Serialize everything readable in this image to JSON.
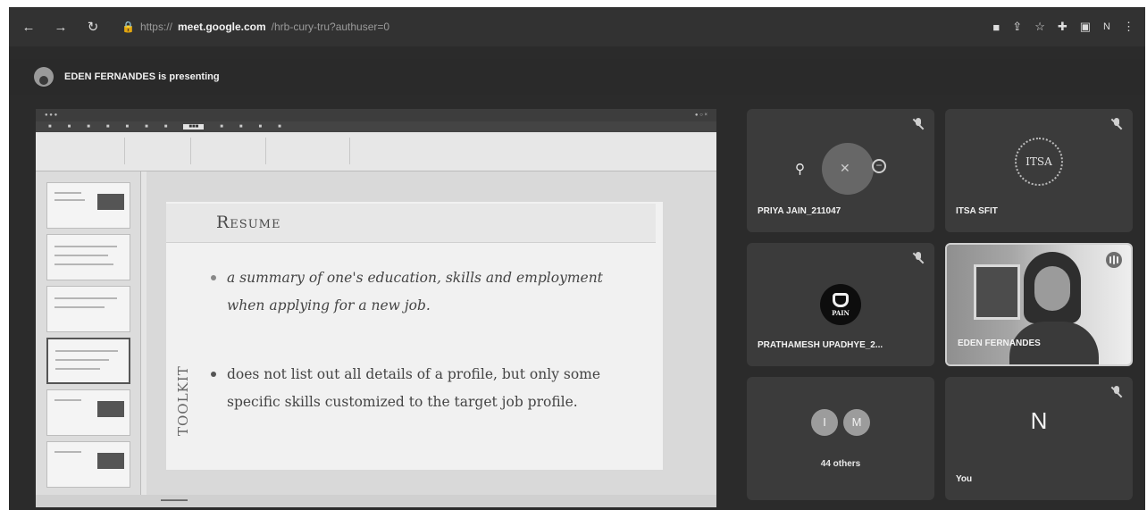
{
  "browser": {
    "url_prefix": "https://",
    "url_domain": "meet.google.com",
    "url_path": "/hrb-cury-tru?authuser=0",
    "profile_initial": "N"
  },
  "meeting": {
    "presenting_text": "EDEN FERNANDES is presenting"
  },
  "presentation": {
    "slide_title": "Resume",
    "vertical_label": "TOOLKIT",
    "bullets": [
      "a summary of one's education, skills and employment when applying for a new job.",
      "does not list out all details of a profile, but only some specific skills customized to the target job profile."
    ]
  },
  "participants": [
    {
      "name": "PRIYA JAIN_211047"
    },
    {
      "name": "ITSA SFIT",
      "logo_text": "ITSA"
    },
    {
      "name": "PRATHAMESH UPADHYE_2...",
      "avatar_text": "PAIN"
    },
    {
      "name": "EDEN FERNANDES"
    },
    {
      "name": "44 others",
      "initials": [
        "I",
        "M"
      ]
    },
    {
      "name": "You",
      "initial": "N"
    }
  ],
  "colors": {
    "background": "#2b2b2b",
    "tile": "#3b3b3b",
    "slide": "#f1f1f1"
  }
}
